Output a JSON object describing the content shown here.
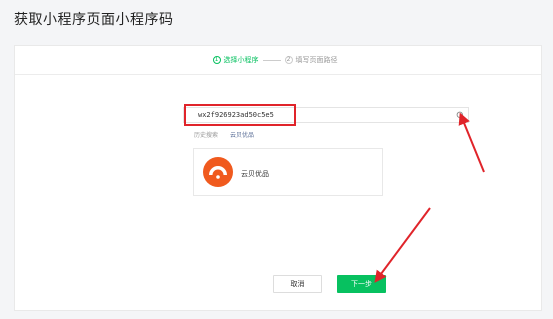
{
  "page": {
    "title": "获取小程序页面小程序码"
  },
  "steps": [
    {
      "num": "①",
      "label": "选择小程序"
    },
    {
      "num": "②",
      "label": "填写页面路径"
    }
  ],
  "search": {
    "value": "wx2f926923ad50c5e5",
    "placeholder": ""
  },
  "history": {
    "label": "历史搜索",
    "items": [
      "云贝优品"
    ]
  },
  "result": {
    "name": "云贝优品"
  },
  "buttons": {
    "cancel": "取消",
    "next": "下一步"
  },
  "colors": {
    "accent": "#07c160",
    "annotation": "#e0242a",
    "logo": "#f05a1e"
  }
}
